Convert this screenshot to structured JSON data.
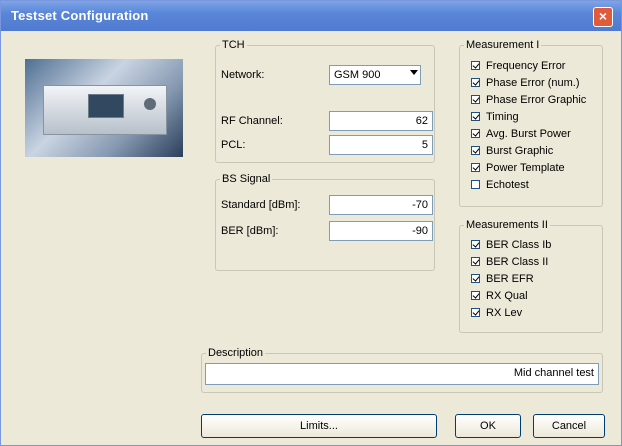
{
  "window": {
    "title": "Testset Configuration",
    "close_glyph": "×"
  },
  "tch": {
    "legend": "TCH",
    "network_label": "Network:",
    "network_value": "GSM 900",
    "rf_label": "RF Channel:",
    "rf_value": "62",
    "pcl_label": "PCL:",
    "pcl_value": "5"
  },
  "bs": {
    "legend": "BS Signal",
    "standard_label": "Standard [dBm]:",
    "standard_value": "-70",
    "ber_label": "BER [dBm]:",
    "ber_value": "-90"
  },
  "measurement1": {
    "legend": "Measurement I",
    "items": [
      {
        "label": "Frequency Error",
        "checked": true
      },
      {
        "label": "Phase Error (num.)",
        "checked": true
      },
      {
        "label": "Phase Error Graphic",
        "checked": true
      },
      {
        "label": "Timing",
        "checked": true
      },
      {
        "label": "Avg. Burst Power",
        "checked": true
      },
      {
        "label": "Burst Graphic",
        "checked": true
      },
      {
        "label": "Power Template",
        "checked": true
      },
      {
        "label": "Echotest",
        "checked": false
      }
    ]
  },
  "measurement2": {
    "legend": "Measurements II",
    "items": [
      {
        "label": "BER Class Ib",
        "checked": true
      },
      {
        "label": "BER Class II",
        "checked": true
      },
      {
        "label": "BER EFR",
        "checked": true
      },
      {
        "label": "RX Qual",
        "checked": true
      },
      {
        "label": "RX Lev",
        "checked": true
      }
    ]
  },
  "description": {
    "legend": "Description",
    "value": "Mid channel test"
  },
  "buttons": {
    "limits": "Limits...",
    "ok": "OK",
    "cancel": "Cancel"
  },
  "colors": {
    "titlebar": "#5a86d9",
    "dialog_bg": "#ece9d8",
    "close": "#e05a3c"
  }
}
